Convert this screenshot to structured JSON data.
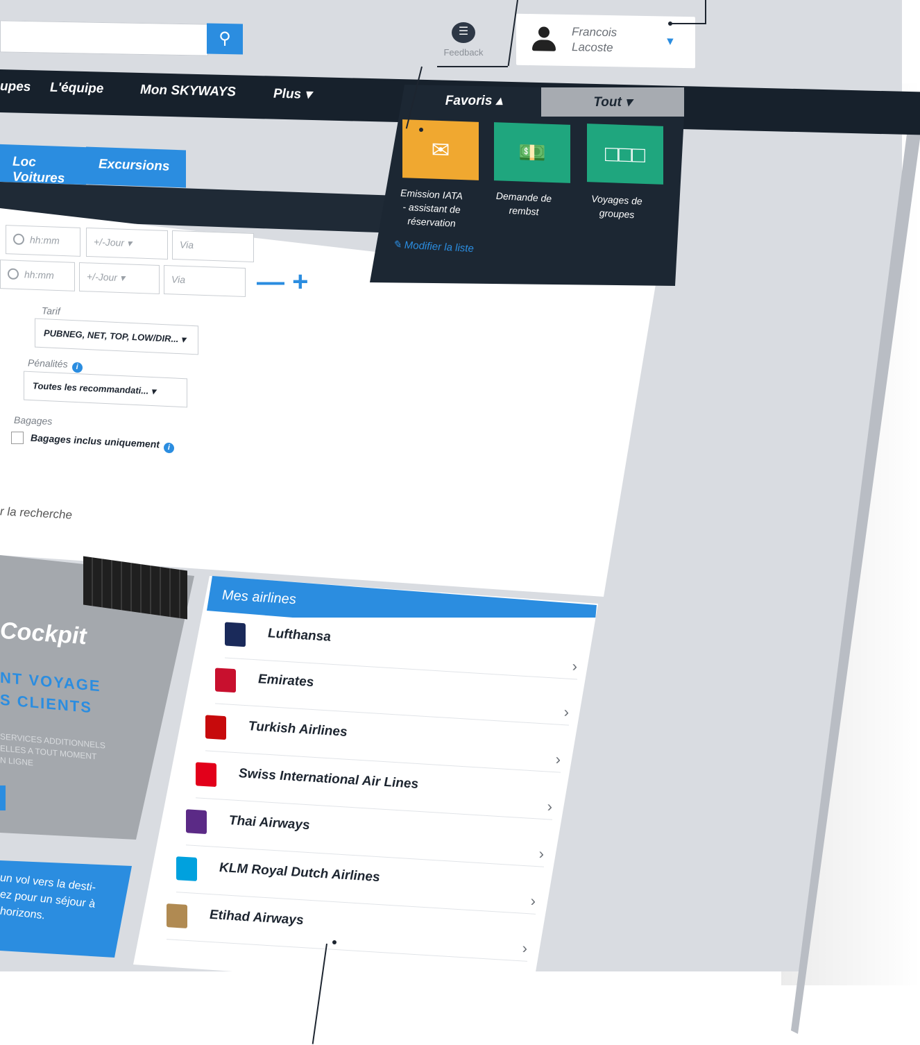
{
  "header": {
    "search_icon": "search-icon",
    "feedback_label": "Feedback",
    "user": {
      "first_name": "Francois",
      "last_name": "Lacoste"
    }
  },
  "nav": {
    "items": [
      "upes",
      "L'équipe",
      "Mon SKYWAYS",
      "Plus ▾"
    ]
  },
  "tabs": [
    "Loc Voitures",
    "Excursions"
  ],
  "favoris": {
    "tab_favoris": "Favoris ▴",
    "tab_tout": "Tout ▾",
    "tiles": [
      {
        "label_1": "Emission IATA",
        "label_2": "- assistant de",
        "label_3": "réservation",
        "color": "#f0a830",
        "icon": "ticket-icon"
      },
      {
        "label_1": "Demande de",
        "label_2": "rembst",
        "label_3": "",
        "color": "#1fa67e",
        "icon": "money-icon"
      },
      {
        "label_1": "Voyages de",
        "label_2": "groupes",
        "label_3": "",
        "color": "#1fa67e",
        "icon": "seats-icon"
      }
    ],
    "modify_label": "Modifier la liste"
  },
  "form": {
    "row1": {
      "time": "hh:mm",
      "day": "+/-Jour",
      "via": "Via"
    },
    "row2": {
      "time": "hh:mm",
      "day": "+/-Jour",
      "via": "Via"
    },
    "minus_plus": "— +",
    "tarif_label": "Tarif",
    "tarif_value": "PUBNEG, NET, TOP, LOW/DIR... ▾",
    "penalites_label": "Pénalités",
    "penalites_value": "Toutes les recommandati... ▾",
    "bagages_label": "Bagages",
    "bagages_checkbox": "Bagages inclus uniquement",
    "search_link": "r la recherche"
  },
  "cockpit": {
    "title": "Cockpit",
    "subtitle_1": "NT VOYAGE",
    "subtitle_2": "S CLIENTS",
    "desc_1": "SERVICES ADDITIONNELS",
    "desc_2": "ELLES A TOUT MOMENT",
    "desc_3": "N LIGNE"
  },
  "promo": {
    "line_1": "un vol vers la desti-",
    "line_2": "ez pour un séjour à",
    "line_3": "horizons."
  },
  "airlines": {
    "title": "Mes airlines",
    "items": [
      {
        "name": "Lufthansa",
        "color": "#1a2a5a"
      },
      {
        "name": "Emirates",
        "color": "#c8102e"
      },
      {
        "name": "Turkish Airlines",
        "color": "#c70a0c"
      },
      {
        "name": "Swiss International Air Lines",
        "color": "#e2001a"
      },
      {
        "name": "Thai Airways",
        "color": "#5b2a86"
      },
      {
        "name": "KLM Royal Dutch Airlines",
        "color": "#00a1de"
      },
      {
        "name": "Etihad Airways",
        "color": "#b08a52"
      }
    ]
  }
}
